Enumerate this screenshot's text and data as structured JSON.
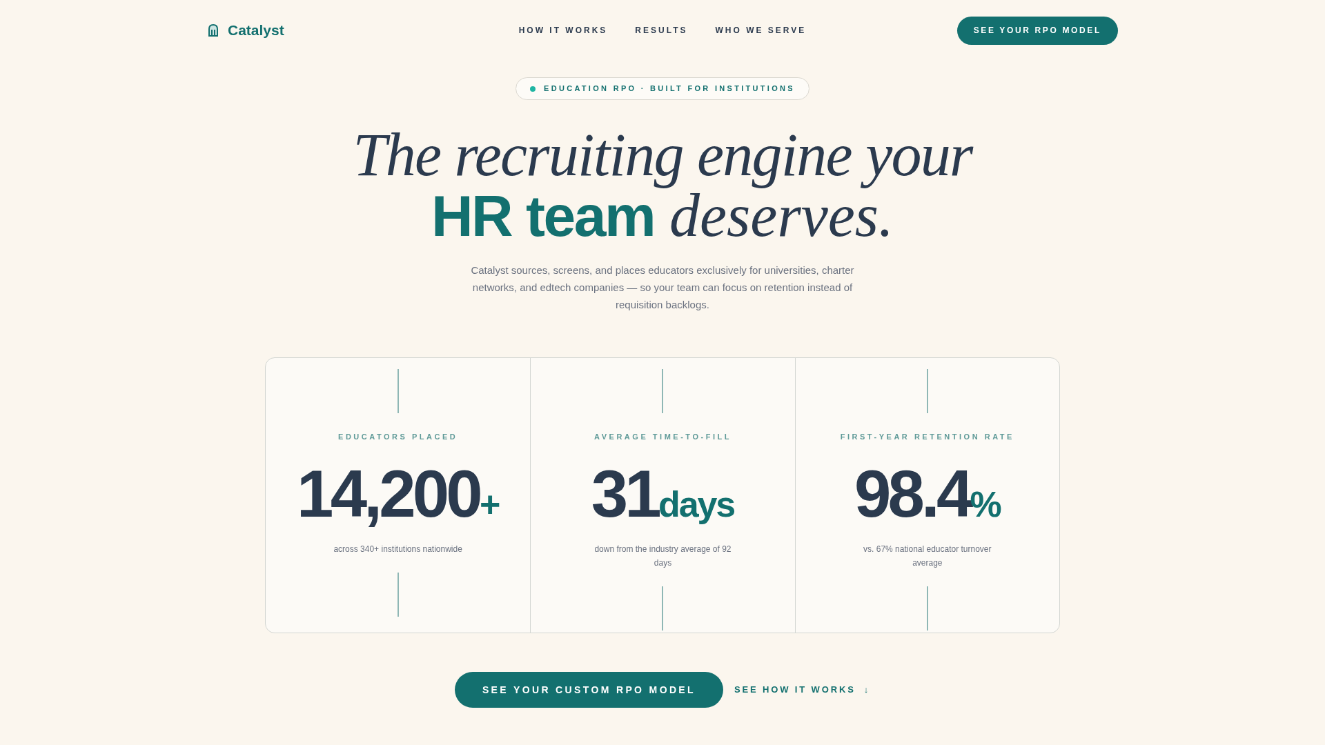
{
  "header": {
    "brand": "Catalyst",
    "nav": [
      "HOW IT WORKS",
      "RESULTS",
      "WHO WE SERVE"
    ],
    "cta": "SEE YOUR RPO MODEL"
  },
  "badge": "EDUCATION RPO · BUILT FOR INSTITUTIONS",
  "headline": {
    "line_1": "The recruiting engine your",
    "highlight": "HR team",
    "rest": "deserves."
  },
  "intro": "Catalyst sources, screens, and places educators exclusively for universities, charter networks, and edtech companies — so your team can focus on retention instead of requisition backlogs.",
  "stats": [
    {
      "label": "EDUCATORS PLACED",
      "value": "14,200",
      "suffix": "+",
      "note": "across 340+ institutions nationwide"
    },
    {
      "label": "AVERAGE TIME-TO-FILL",
      "value": "31",
      "suffix": "days",
      "note": "down from the industry average of 92 days"
    },
    {
      "label": "FIRST-YEAR RETENTION RATE",
      "value": "98.4",
      "suffix": "%",
      "note": "vs. 67% national educator turnover average"
    }
  ],
  "actions": {
    "primary": "SEE YOUR CUSTOM RPO MODEL",
    "secondary": "SEE HOW IT WORKS",
    "secondary_icon": "↓"
  }
}
